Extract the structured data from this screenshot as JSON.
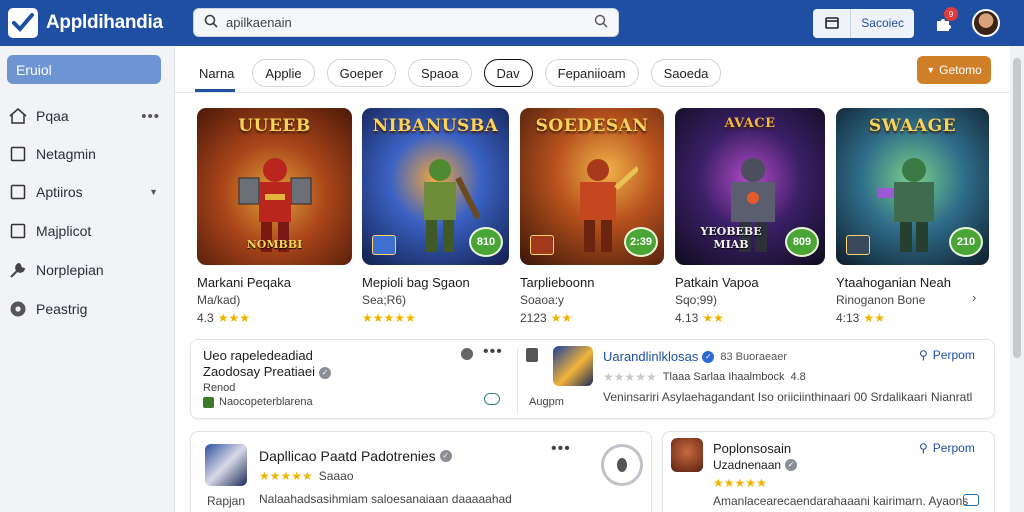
{
  "app": {
    "name": "Appldihandia"
  },
  "search": {
    "placeholder": "apilkaenain",
    "value": "apilkaenain"
  },
  "topbar": {
    "action_label": "Sacoiec",
    "ext_badge": "9"
  },
  "sidebar": {
    "active": {
      "label": "Eruiol"
    },
    "items": [
      {
        "label": "Pqaa",
        "icon": "home-icon",
        "extra": "more"
      },
      {
        "label": "Netagmin",
        "icon": "square-icon"
      },
      {
        "label": "Aptiiros",
        "icon": "square-icon",
        "extra": "chevron"
      },
      {
        "label": "Majplicot",
        "icon": "square-icon"
      },
      {
        "label": "Norplepian",
        "icon": "wrench-icon"
      },
      {
        "label": "Peastrig",
        "icon": "gear-icon"
      }
    ]
  },
  "tabs": [
    {
      "label": "Narna",
      "selected": false
    },
    {
      "label": "Applie",
      "selected": false
    },
    {
      "label": "Goeper",
      "selected": false
    },
    {
      "label": "Spaoa",
      "selected": false
    },
    {
      "label": "Dav",
      "selected": true
    },
    {
      "label": "Fepaniioam",
      "selected": false
    },
    {
      "label": "Saoeda",
      "selected": false
    }
  ],
  "cta": {
    "label": "Getomo"
  },
  "games": [
    {
      "art_title": "UUEEB",
      "art_subtitle": "NOMBBI",
      "badge": "",
      "name": "Markani Peqaka",
      "sub": "Ma/kad)",
      "rating": "4.3",
      "colors": [
        "#8b2c10",
        "#e4a33a"
      ]
    },
    {
      "art_title": "NIBANUSBA",
      "art_subtitle": "",
      "badge": "810",
      "name": "Mepioli bag Sgaon",
      "sub": "Sea;R6)",
      "rating": "",
      "colors": [
        "#1a3b8f",
        "#f2a640"
      ]
    },
    {
      "art_title": "SOEDESAN",
      "art_subtitle": "",
      "badge": "2:39",
      "name": "Tarplieboonn",
      "sub": "Soaoa:y",
      "rating": "2123",
      "colors": [
        "#5a1d0c",
        "#d5852d"
      ]
    },
    {
      "art_title": "AVACE",
      "art_subtitle": "YEOBEBE MIAB",
      "badge": "809",
      "name": "Patkain Vapoa",
      "sub": "Sqo;99)",
      "rating": "4.13",
      "colors": [
        "#1b1433",
        "#8a3aa8"
      ]
    },
    {
      "art_title": "SWAAGE",
      "art_subtitle": "",
      "badge": "210",
      "name": "Ytaahoganian Neah",
      "sub": "Rinoganon Bone",
      "rating": "4:13",
      "colors": [
        "#12303a",
        "#5bb37a"
      ]
    }
  ],
  "panel_a": {
    "title": "Ueo rapeledeadiad",
    "subtitle": "Zaodosay Preatiaei",
    "meta": "Renod",
    "link": "Naocopeterblarena",
    "app_title": "Uarandlinlklosas",
    "app_rating_text": "Tlaaa Sarlaa Ihaalmbock",
    "app_rating_extra": "4.8",
    "app_extra": "83 Buoraeaer",
    "app_desc": "Veninsariri Asylaehagandant Iso oriiciinthinaari 00 Srdalikaari",
    "app_cta": "Nianratl",
    "app_meta": "Augpm",
    "report": "Perpom"
  },
  "panel_b": {
    "title": "Dapllicao Paatd Padotrenies",
    "reviews": "Saaao",
    "desc": "Nalaahadsasihmiam saloesanaiaan daaaaahad",
    "meta": "Rapjan"
  },
  "panel_c": {
    "title": "Poplonsosain",
    "subtitle": "Uzadnenaan",
    "desc": "Amanlacearecaendarahaaani kairimarn. Ayaons",
    "report": "Perpom"
  }
}
